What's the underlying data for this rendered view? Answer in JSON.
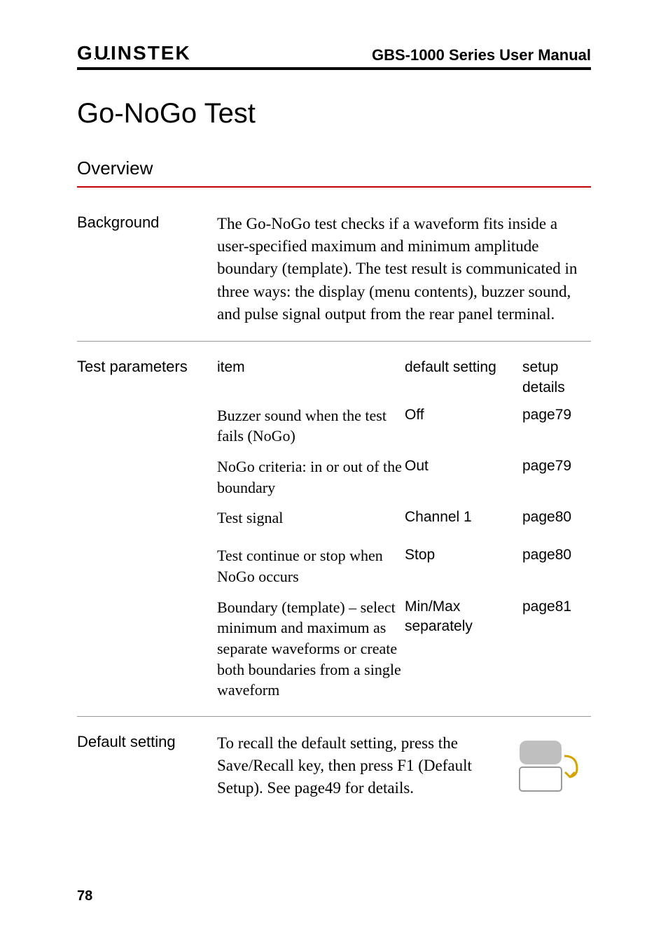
{
  "header": {
    "logo": "GWINSTEK",
    "right": "GBS-1000 Series User Manual"
  },
  "section_title": "Go-NoGo Test",
  "overview": {
    "heading": "Overview"
  },
  "background": {
    "label": "Background",
    "text": "The Go-NoGo test checks if a waveform fits inside a user-specified maximum and minimum amplitude boundary (template). The test result is communicated in three ways: the display (menu contents), buzzer sound, and pulse signal output from the rear panel terminal."
  },
  "test_params": {
    "label": "Test parameters",
    "head": {
      "item": "item",
      "def": "default setting",
      "det": "setup details"
    },
    "rows": [
      {
        "item": "Buzzer sound when the test fails (NoGo)",
        "def": "Off",
        "det": "page79"
      },
      {
        "item": "NoGo criteria: in or out of the boundary",
        "def": "Out",
        "det": "page79"
      },
      {
        "item": "Test signal",
        "def": "Channel 1",
        "det": "page80"
      },
      {
        "item": "Test continue or stop when NoGo occurs",
        "def": "Stop",
        "det": "page80"
      },
      {
        "item": "Boundary (template) – select minimum and maximum as separate waveforms or create both boundaries from a single waveform",
        "def": "Min/Max separately",
        "det": "page81"
      }
    ]
  },
  "default_setting": {
    "label": "Default setting",
    "text": "To recall the default setting, press the Save/Recall key, then press F1 (Default Setup). See page49 for details."
  },
  "page_number": "78"
}
